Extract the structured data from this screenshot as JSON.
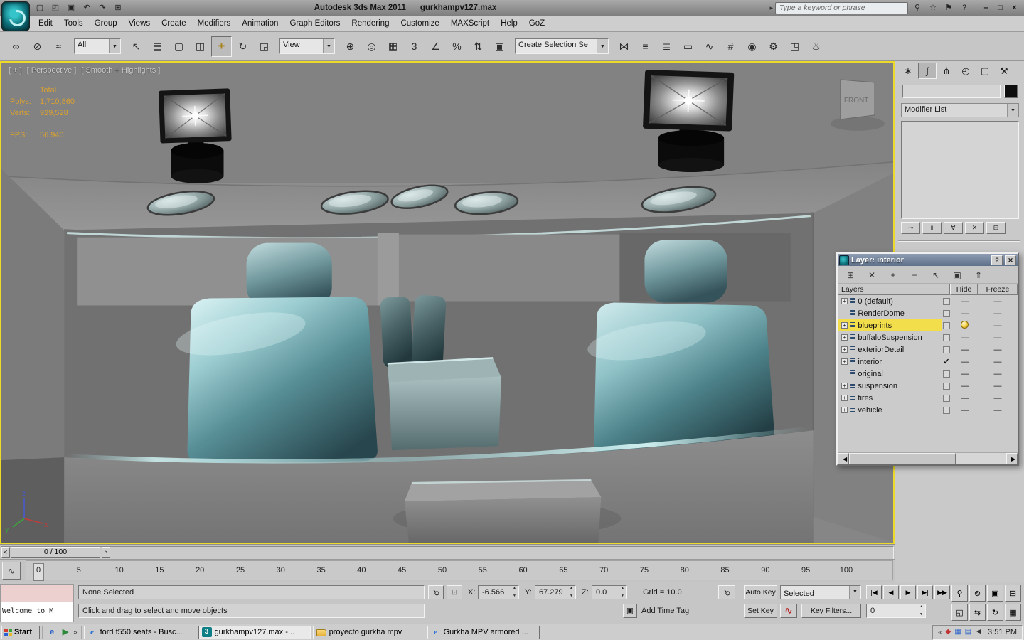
{
  "ui": {
    "dropdown_arrow": "▼",
    "spinner_up": "▲",
    "spinner_down": "▼"
  },
  "title_bar": {
    "app_title": "Autodesk 3ds Max  2011",
    "file_name": "gurkhampv127.max",
    "infocenter_arrow": "▸",
    "search": {
      "placeholder": "Type a keyword or phrase"
    },
    "left_icons": [
      {
        "name": "new-scene-icon",
        "glyph": "▢"
      },
      {
        "name": "open-file-icon",
        "glyph": "◰"
      },
      {
        "name": "save-file-icon",
        "glyph": "▣"
      },
      {
        "name": "undo-icon",
        "glyph": "↶"
      },
      {
        "name": "redo-icon",
        "glyph": "↷"
      },
      {
        "name": "project-folder-icon",
        "glyph": "⊞"
      }
    ],
    "right_icons": [
      {
        "name": "search-icon",
        "glyph": "⚲"
      },
      {
        "name": "communication-center-icon",
        "glyph": "☆"
      },
      {
        "name": "favorites-icon",
        "glyph": "⚑"
      },
      {
        "name": "help-icon",
        "glyph": "?"
      }
    ],
    "window_controls": [
      {
        "name": "minimize-button",
        "glyph": "–"
      },
      {
        "name": "maximize-button",
        "glyph": "□"
      },
      {
        "name": "close-button",
        "glyph": "×"
      }
    ]
  },
  "menu_bar": {
    "items": [
      "Edit",
      "Tools",
      "Group",
      "Views",
      "Create",
      "Modifiers",
      "Animation",
      "Graph Editors",
      "Rendering",
      "Customize",
      "MAXScript",
      "Help",
      "GoZ"
    ]
  },
  "toolbar": {
    "selection_filter": {
      "value": "All"
    },
    "reference_coordinate": {
      "value": "View"
    },
    "named_selection": {
      "value": "Create Selection Se"
    },
    "group_link": [
      {
        "name": "select-and-link-icon",
        "glyph": "∞"
      },
      {
        "name": "unlink-selection-icon",
        "glyph": "⊘"
      },
      {
        "name": "bind-to-space-warp-icon",
        "glyph": "≈"
      }
    ],
    "group_select": [
      {
        "name": "select-object-icon",
        "glyph": "↖"
      },
      {
        "name": "select-by-name-icon",
        "glyph": "▤"
      },
      {
        "name": "selection-region-icon",
        "glyph": "▢"
      },
      {
        "name": "window-crossing-icon",
        "glyph": "◫"
      },
      {
        "name": "select-and-move-icon",
        "glyph": "+",
        "active": true
      },
      {
        "name": "select-and-rotate-icon",
        "glyph": "↻"
      },
      {
        "name": "select-and-scale-icon",
        "glyph": "◲"
      }
    ],
    "group_snap": [
      {
        "name": "use-pivot-center-icon",
        "glyph": "⊕"
      },
      {
        "name": "select-and-manipulate-icon",
        "glyph": "◎"
      },
      {
        "name": "keyboard-override-icon",
        "glyph": "▦"
      },
      {
        "name": "snap-toggle-3d-icon",
        "glyph": "3"
      },
      {
        "name": "angle-snap-icon",
        "glyph": "∠"
      },
      {
        "name": "percent-snap-icon",
        "glyph": "%"
      },
      {
        "name": "spinner-snap-icon",
        "glyph": "⇅"
      },
      {
        "name": "named-selection-sets-icon",
        "glyph": "▣"
      }
    ],
    "group_render": [
      {
        "name": "mirror-icon",
        "glyph": "⋈"
      },
      {
        "name": "align-icon",
        "glyph": "≡"
      },
      {
        "name": "layer-manager-icon",
        "glyph": "≣"
      },
      {
        "name": "graphite-ribbon-icon",
        "glyph": "▭"
      },
      {
        "name": "curve-editor-icon",
        "glyph": "∿"
      },
      {
        "name": "schematic-view-icon",
        "glyph": "#"
      },
      {
        "name": "material-editor-icon",
        "glyph": "◉"
      },
      {
        "name": "render-setup-icon",
        "glyph": "⚙"
      },
      {
        "name": "rendered-frame-icon",
        "glyph": "◳"
      },
      {
        "name": "render-production-icon",
        "glyph": "♨"
      }
    ]
  },
  "viewport": {
    "label_general": "[ + ]",
    "label_pov": "[ Perspective ]",
    "label_shading": "[ Smooth + Highlights ]",
    "stats": [
      {
        "label": "",
        "value": "Total"
      },
      {
        "label": "Polys:",
        "value": "1,710,860"
      },
      {
        "label": "Verts:",
        "value": "929,528"
      },
      {
        "label": "FPS:",
        "value": "56.940",
        "gap": true
      }
    ],
    "scene": {
      "front_label": "FRONT",
      "axis": {
        "x": "x",
        "y": "y",
        "z": "z"
      }
    }
  },
  "command_panel": {
    "tabs": [
      {
        "name": "tab-create",
        "glyph": "∗"
      },
      {
        "name": "tab-modify",
        "glyph": "∫",
        "active": true
      },
      {
        "name": "tab-hierarchy",
        "glyph": "⋔"
      },
      {
        "name": "tab-motion",
        "glyph": "◴"
      },
      {
        "name": "tab-display",
        "glyph": "▢"
      },
      {
        "name": "tab-utilities",
        "glyph": "⚒"
      }
    ],
    "object_name": {
      "value": ""
    },
    "modifier_list_label": "Modifier List",
    "stack_buttons": [
      {
        "name": "pin-stack-icon",
        "glyph": "⊸"
      },
      {
        "name": "show-end-result-icon",
        "glyph": "‖"
      },
      {
        "name": "make-unique-icon",
        "glyph": "∀"
      },
      {
        "name": "remove-modifier-icon",
        "glyph": "✕"
      },
      {
        "name": "configure-modifier-sets-icon",
        "glyph": "⊞"
      }
    ]
  },
  "layer_dialog": {
    "title": "Layer: interior",
    "help_glyph": "?",
    "close_glyph": "✕",
    "row_icon_glyph": "≣",
    "toolbar": [
      {
        "name": "new-layer-icon",
        "glyph": "⊞"
      },
      {
        "name": "delete-layer-icon",
        "glyph": "✕"
      },
      {
        "name": "add-to-layer-icon",
        "glyph": "+"
      },
      {
        "name": "remove-from-layer-icon",
        "glyph": "−"
      },
      {
        "name": "select-layer-objects-icon",
        "glyph": "↖"
      },
      {
        "name": "set-current-layer-icon",
        "glyph": "▣"
      },
      {
        "name": "hide-unhide-all-icon",
        "glyph": "⇑"
      }
    ],
    "columns": {
      "layers": "Layers",
      "hide": "Hide",
      "freeze": "Freeze"
    },
    "rows": [
      {
        "name": "0 (default)",
        "expand": "+",
        "box": true,
        "check": "",
        "hide": "—",
        "freeze": "—"
      },
      {
        "name": "RenderDome",
        "expand": "",
        "box": true,
        "check": "",
        "hide": "—",
        "freeze": "—"
      },
      {
        "name": "blueprints",
        "expand": "+",
        "box": true,
        "check": "",
        "hide": "",
        "freeze": "—",
        "selected": true,
        "bulb": true
      },
      {
        "name": "buffaloSuspension",
        "expand": "+",
        "box": true,
        "check": "",
        "hide": "—",
        "freeze": "—"
      },
      {
        "name": "exteriorDetail",
        "expand": "+",
        "box": true,
        "check": "",
        "hide": "—",
        "freeze": "—"
      },
      {
        "name": "interior",
        "expand": "+",
        "box": false,
        "check": "✓",
        "hide": "—",
        "freeze": "—"
      },
      {
        "name": "original",
        "expand": "",
        "box": true,
        "check": "",
        "hide": "—",
        "freeze": "—"
      },
      {
        "name": "suspension",
        "expand": "+",
        "box": true,
        "check": "",
        "hide": "—",
        "freeze": "—"
      },
      {
        "name": "tires",
        "expand": "+",
        "box": true,
        "check": "",
        "hide": "—",
        "freeze": "—"
      },
      {
        "name": "vehicle",
        "expand": "+",
        "box": true,
        "check": "",
        "hide": "—",
        "freeze": "—"
      }
    ],
    "scroll": {
      "left_glyph": "◀",
      "right_glyph": "▶"
    }
  },
  "time_slider": {
    "value": "0 / 100",
    "left_glyph": "<",
    "right_glyph": ">"
  },
  "track_bar": {
    "curve_glyph": "∿",
    "ticks": [
      "0",
      "5",
      "10",
      "15",
      "20",
      "25",
      "30",
      "35",
      "40",
      "45",
      "50",
      "55",
      "60",
      "65",
      "70",
      "75",
      "80",
      "85",
      "90",
      "95",
      "100"
    ]
  },
  "status_bar": {
    "listener_text": "Welcome to M",
    "selection_status": "None Selected",
    "prompt": "Click and drag to select and move objects",
    "coords": {
      "x_label": "X:",
      "x": "-6.566",
      "y_label": "Y:",
      "y": "67.279",
      "z_label": "Z:",
      "z": "0.0"
    },
    "grid_label": "Grid = 10.0",
    "time_tag_label": "Add Time Tag",
    "time_tag_icon_glyph": "▣",
    "lock_glyph": "⚲",
    "abs_offset_glyph": "⊡",
    "key_glyph": "⚲",
    "auto_key_label": "Auto Key",
    "set_key_label": "Set Key",
    "key_mode": {
      "value": "Selected"
    },
    "key_filters_label": "Key Filters...",
    "setkey_curve_glyph": "∿",
    "frame_value": "0",
    "playback": [
      {
        "name": "go-to-start-button",
        "glyph": "|◀"
      },
      {
        "name": "previous-frame-button",
        "glyph": "◀"
      },
      {
        "name": "play-button",
        "glyph": "▶"
      },
      {
        "name": "next-frame-button",
        "glyph": "▶|"
      },
      {
        "name": "go-to-end-button",
        "glyph": "▶▶"
      }
    ],
    "nav_row1": [
      {
        "name": "zoom-icon",
        "glyph": "⚲"
      },
      {
        "name": "zoom-all-icon",
        "glyph": "⊚"
      },
      {
        "name": "zoom-extents-icon",
        "glyph": "▣"
      },
      {
        "name": "zoom-extents-all-icon",
        "glyph": "⊞"
      }
    ],
    "nav_row2": [
      {
        "name": "zoom-region-icon",
        "glyph": "◱"
      },
      {
        "name": "pan-icon",
        "glyph": "⇆"
      },
      {
        "name": "arc-rotate-icon",
        "glyph": "↻"
      },
      {
        "name": "maximize-viewport-icon",
        "glyph": "▦"
      }
    ]
  },
  "taskbar": {
    "start_label": "Start",
    "chevron_more": "»",
    "chevron_tray": "«",
    "quick_launch": [
      {
        "name": "ie-quicklaunch-icon",
        "glyph": "e",
        "tone": "blue"
      },
      {
        "name": "media-quicklaunch-icon",
        "glyph": "▶",
        "tone": "green"
      }
    ],
    "buttons": [
      {
        "label": "ford f550 seats - Busc...",
        "icon": "ie",
        "icon_glyph": "e"
      },
      {
        "label": "gurkhampv127.max -...",
        "icon": "max",
        "icon_glyph": "3",
        "active": true
      },
      {
        "label": "proyecto gurkha mpv",
        "icon": "folder",
        "icon_glyph": ""
      },
      {
        "label": "Gurkha MPV armored ...",
        "icon": "ie",
        "icon_glyph": "e"
      }
    ],
    "tray_icons": [
      {
        "name": "update-tray-icon",
        "glyph": "◆",
        "tone": "red"
      },
      {
        "name": "display-tray-icon",
        "glyph": "▦",
        "tone": "blue"
      },
      {
        "name": "network-tray-icon",
        "glyph": "▤",
        "tone": "blue"
      },
      {
        "name": "volume-tray-icon",
        "glyph": "◄",
        "tone": "dark"
      }
    ],
    "clock": "3:51 PM"
  }
}
